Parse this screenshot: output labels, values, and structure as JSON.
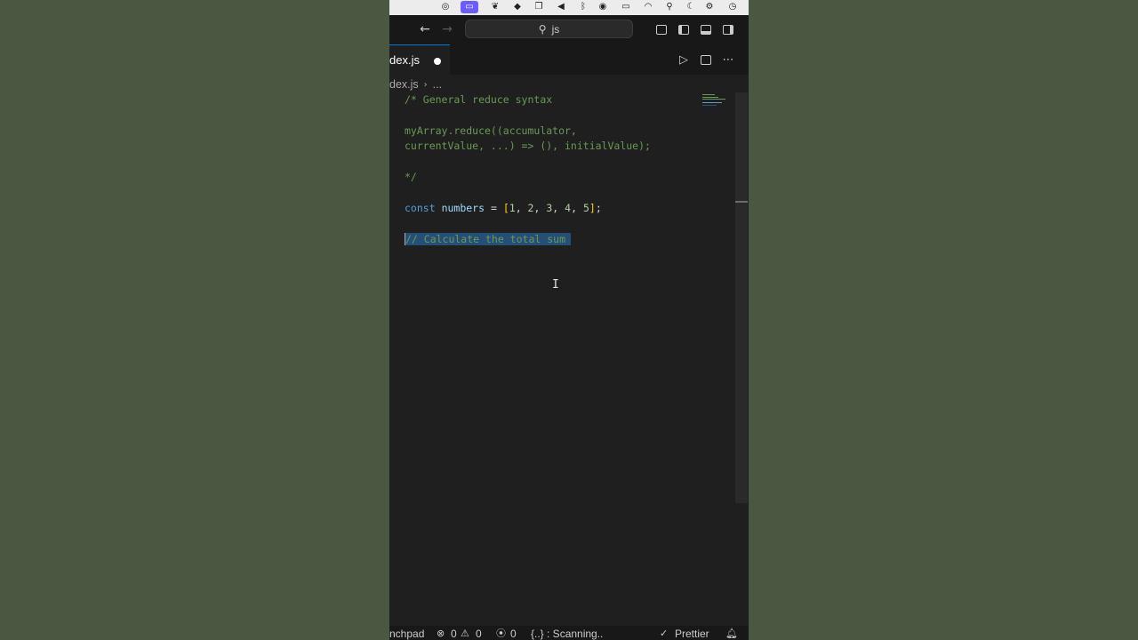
{
  "menubar": {
    "icons": [
      "creative-cloud-icon",
      "screen-share-icon",
      "butterfly-icon",
      "app-icon",
      "layers-icon",
      "volume-icon",
      "bluetooth-icon",
      "record-icon",
      "battery-icon",
      "wifi-icon",
      "spotlight-search-icon",
      "moon-icon",
      "control-center-icon",
      "clock-icon"
    ]
  },
  "titlebar": {
    "search_text": "js"
  },
  "tab": {
    "label": "dex.js"
  },
  "breadcrumb": {
    "file": "dex.js",
    "ellipsis": "..."
  },
  "code": {
    "line1": "/* General reduce syntax",
    "line2": "myArray.reduce((accumulator,",
    "line3": "currentValue, ...) => (), initialValue);",
    "line4": "*/",
    "l5_kw": "const",
    "l5_var": "numbers",
    "l5_eq": " = ",
    "l5_ob": "[",
    "l5_n1": "1",
    "l5_n2": "2",
    "l5_n3": "3",
    "l5_n4": "4",
    "l5_n5": "5",
    "l5_comma": ", ",
    "l5_cb": "]",
    "l5_semi": ";",
    "line6": "// Calculate the total sum"
  },
  "statusbar": {
    "left_label": "nchpad",
    "errors": "0",
    "warnings": "0",
    "ports": "0",
    "scanning": "{..} : Scanning..",
    "prettier": "Prettier"
  },
  "colors": {
    "background": "#4b5740",
    "editor": "#1f1f1f",
    "comment": "#6a9955",
    "keyword": "#569cd6",
    "selection": "#264f78"
  }
}
